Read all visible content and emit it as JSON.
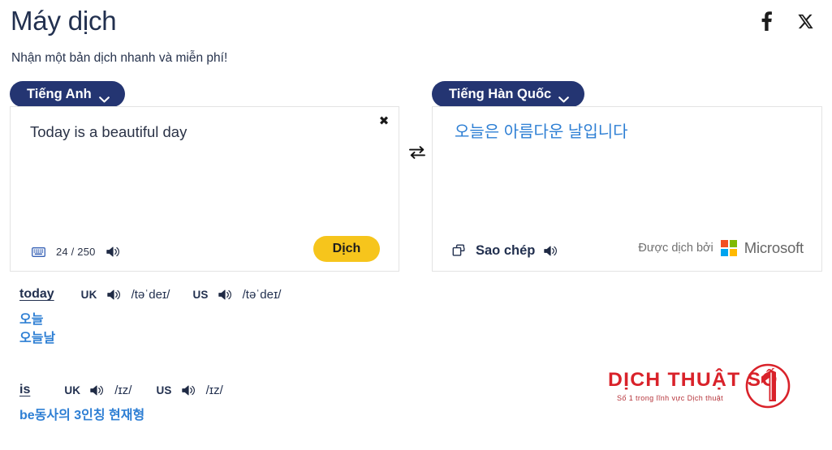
{
  "header": {
    "title": "Máy dịch",
    "subtitle": "Nhận một bản dịch nhanh và miễn phí!",
    "social": [
      {
        "name": "facebook-icon",
        "label": "f"
      },
      {
        "name": "x-twitter-icon",
        "label": "X"
      }
    ]
  },
  "source_panel": {
    "language": "Tiếng Anh",
    "text": "Today is a beautiful day",
    "char_count": "24 / 250",
    "close_label": "✖",
    "keyboard_icon": "keyboard-icon",
    "speaker_icon": "speaker-icon",
    "translate_label": "Dịch"
  },
  "target_panel": {
    "language": "Tiếng Hàn Quốc",
    "text": "오늘은 아름다운 날입니다",
    "copy_label": "Sao chép",
    "copy_icon": "copy-icon",
    "speaker_icon": "speaker-icon",
    "attribution_text": "Được dịch bởi",
    "provider": "Microsoft"
  },
  "swap_icon": "swap-languages-icon",
  "dictionary": [
    {
      "word": "today",
      "uk_label": "UK",
      "uk_phonetic": "/təˈdeɪ/",
      "us_label": "US",
      "us_phonetic": "/təˈdeɪ/",
      "meanings": [
        "오늘",
        "오늘날"
      ]
    },
    {
      "word": "is",
      "uk_label": "UK",
      "uk_phonetic": "/ɪz/",
      "us_label": "US",
      "us_phonetic": "/ɪz/",
      "meanings": [
        "be동사의 3인칭 현재형"
      ]
    }
  ],
  "brand": {
    "name": "DỊCH THUẬT SỐ",
    "tagline": "Số 1 trong lĩnh vực Dịch thuật",
    "mark_number": "1"
  },
  "colors": {
    "navy": "#243572",
    "yellow": "#f6c51c",
    "blue_text": "#2e7fd4",
    "brand_red": "#d9222a",
    "ms_red": "#f25022",
    "ms_green": "#7fba00",
    "ms_blue": "#00a4ef",
    "ms_yellow": "#ffb900"
  }
}
